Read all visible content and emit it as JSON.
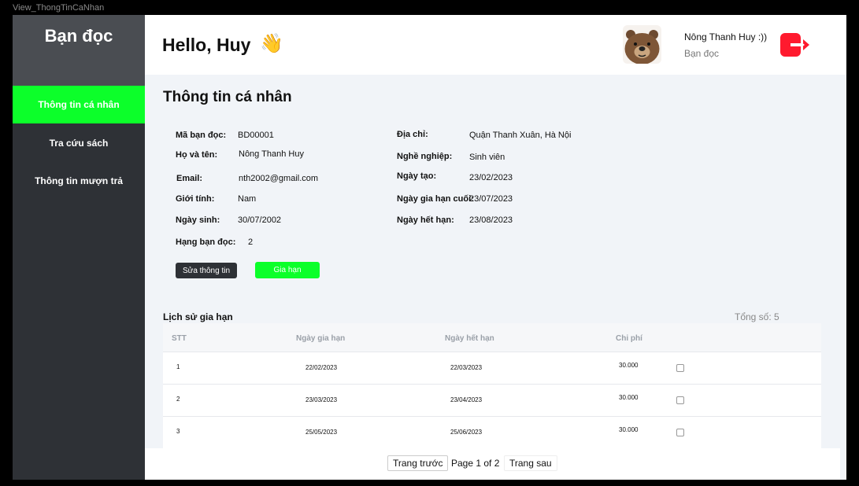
{
  "frame_label": "View_ThongTinCaNhan",
  "sidebar": {
    "title": "Bạn đọc",
    "items": [
      {
        "label": "Thông tin cá nhân"
      },
      {
        "label": "Tra cứu sách"
      },
      {
        "label": "Thông tin mượn trả"
      }
    ],
    "active_color": "#0cff2a"
  },
  "header": {
    "greeting": "Hello, Huy",
    "wave_emoji": "👋",
    "user_name": "Nông Thanh Huy :))",
    "user_role": "Bạn đọc",
    "logout_icon": "logout-icon",
    "logout_color": "#ff1a2e"
  },
  "profile": {
    "title": "Thông tin cá nhân",
    "left": [
      {
        "label": "Mã bạn đọc:",
        "value": "BD00001"
      },
      {
        "label": "Họ và tên:",
        "value": "Nông Thanh Huy"
      },
      {
        "label": "Email:",
        "value": "nth2002@gmail.com"
      },
      {
        "label": "Giới tính:",
        "value": "Nam"
      },
      {
        "label": "Ngày sinh:",
        "value": "30/07/2002"
      },
      {
        "label": "Hạng bạn đọc:",
        "value": "2"
      }
    ],
    "right": [
      {
        "label": "Địa chỉ:",
        "value": "Quận Thanh Xuân,  Hà Nội"
      },
      {
        "label": "Nghề nghiệp:",
        "value": "Sinh viên"
      },
      {
        "label": "Ngày tạo:",
        "value": "23/02/2023"
      },
      {
        "label": "Ngày gia hạn cuối:",
        "value": "23/07/2023"
      },
      {
        "label": "Ngày hết hạn:",
        "value": "23/08/2023"
      }
    ],
    "edit_button": "Sửa thông tin",
    "extend_button": "Gia hạn"
  },
  "history": {
    "title": "Lịch sử gia hạn",
    "total": "Tổng số: 5",
    "columns": [
      "STT",
      "Ngày gia hạn",
      "Ngày hết hạn",
      "Chi phí"
    ],
    "rows": [
      {
        "stt": "1",
        "start": "22/02/2023",
        "end": "22/03/2023",
        "cost": "30.000",
        "checked": false
      },
      {
        "stt": "2",
        "start": "23/03/2023",
        "end": "23/04/2023",
        "cost": "30.000",
        "checked": false
      },
      {
        "stt": "3",
        "start": "25/05/2023",
        "end": "25/06/2023",
        "cost": "30.000",
        "checked": false
      }
    ]
  },
  "pagination": {
    "prev": "Trang trước",
    "status": "Page 1 of 2",
    "next": "Trang sau"
  }
}
